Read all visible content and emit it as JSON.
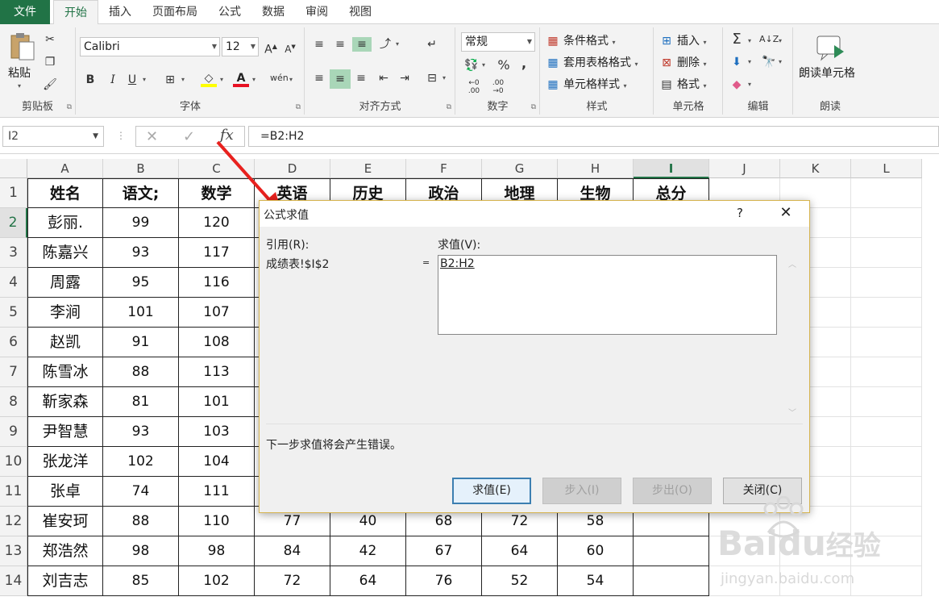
{
  "tabs": [
    {
      "label": "文件",
      "type": "file"
    },
    {
      "label": "开始",
      "active": true
    },
    {
      "label": "插入"
    },
    {
      "label": "页面布局"
    },
    {
      "label": "公式"
    },
    {
      "label": "数据"
    },
    {
      "label": "审阅"
    },
    {
      "label": "视图"
    }
  ],
  "ribbon": {
    "clipboard": {
      "label": "剪贴板",
      "paste": "粘贴"
    },
    "font": {
      "label": "字体",
      "name": "Calibri",
      "size": "12",
      "bold": "B",
      "italic": "I",
      "underline": "U",
      "font_color": "#e81123",
      "fill_color": "#ffff00"
    },
    "align": {
      "label": "对齐方式"
    },
    "number": {
      "label": "数字",
      "format": "常规",
      "percent": "%",
      "comma": ","
    },
    "styles": {
      "label": "样式",
      "cond": "条件格式",
      "table": "套用表格格式",
      "cell": "单元格样式"
    },
    "cells": {
      "label": "单元格",
      "insert": "插入",
      "delete": "删除",
      "format": "格式"
    },
    "edit": {
      "label": "编辑",
      "sum": "Σ"
    },
    "read": {
      "label": "朗读",
      "button": "朗读单元格"
    }
  },
  "formula_bar": {
    "name_box": "I2",
    "formula": "=B2:H2",
    "fx": "fx"
  },
  "grid": {
    "columns": [
      "A",
      "B",
      "C",
      "D",
      "E",
      "F",
      "G",
      "H",
      "I",
      "J",
      "K",
      "L"
    ],
    "selected_column": "I",
    "selected_row": 2,
    "header": [
      "姓名",
      "语文;",
      "数学",
      "英语",
      "历史",
      "政治",
      "地理",
      "生物",
      "总分"
    ],
    "rows": [
      {
        "num": "2",
        "cells": [
          "彭丽.",
          "99",
          "120",
          "",
          "",
          "",
          "",
          "",
          ""
        ]
      },
      {
        "num": "3",
        "cells": [
          "陈嘉兴",
          "93",
          "117",
          "",
          "",
          "",
          "",
          "",
          ""
        ]
      },
      {
        "num": "4",
        "cells": [
          "周露",
          "95",
          "116",
          "",
          "",
          "",
          "",
          "",
          ""
        ]
      },
      {
        "num": "5",
        "cells": [
          "李涧",
          "101",
          "107",
          "",
          "",
          "",
          "",
          "",
          ""
        ]
      },
      {
        "num": "6",
        "cells": [
          "赵凯",
          "91",
          "108",
          "",
          "",
          "",
          "",
          "",
          ""
        ]
      },
      {
        "num": "7",
        "cells": [
          "陈雪冰",
          "88",
          "113",
          "",
          "",
          "",
          "",
          "",
          ""
        ]
      },
      {
        "num": "8",
        "cells": [
          "靳家森",
          "81",
          "101",
          "",
          "",
          "",
          "",
          "",
          ""
        ]
      },
      {
        "num": "9",
        "cells": [
          "尹智慧",
          "93",
          "103",
          "",
          "",
          "",
          "",
          "",
          ""
        ]
      },
      {
        "num": "10",
        "cells": [
          "张龙洋",
          "102",
          "104",
          "",
          "",
          "",
          "",
          "",
          ""
        ]
      },
      {
        "num": "11",
        "cells": [
          "张卓",
          "74",
          "111",
          "",
          "",
          "",
          "",
          "",
          ""
        ]
      },
      {
        "num": "12",
        "cells": [
          "崔安珂",
          "88",
          "110",
          "77",
          "40",
          "68",
          "72",
          "58",
          ""
        ]
      },
      {
        "num": "13",
        "cells": [
          "郑浩然",
          "98",
          "98",
          "84",
          "42",
          "67",
          "64",
          "60",
          ""
        ]
      },
      {
        "num": "14",
        "cells": [
          "刘吉志",
          "85",
          "102",
          "72",
          "64",
          "76",
          "52",
          "54",
          ""
        ]
      }
    ],
    "header_row_num": "1"
  },
  "dialog": {
    "title": "公式求值",
    "help": "?",
    "close": "✕",
    "ref_label": "引用(R):",
    "ref_value": "成绩表!$I$2",
    "equals": "=",
    "eval_label": "求值(V):",
    "eval_value": "B2:H2",
    "message": "下一步求值将会产生错误。",
    "buttons": {
      "evaluate": "求值(E)",
      "step_in": "步入(I)",
      "step_out": "步出(O)",
      "close": "关闭(C)"
    }
  },
  "watermark": {
    "brand": "Bai",
    "brand_mid": "du",
    "brand_cn": "经验",
    "url": "jingyan.baidu.com"
  }
}
